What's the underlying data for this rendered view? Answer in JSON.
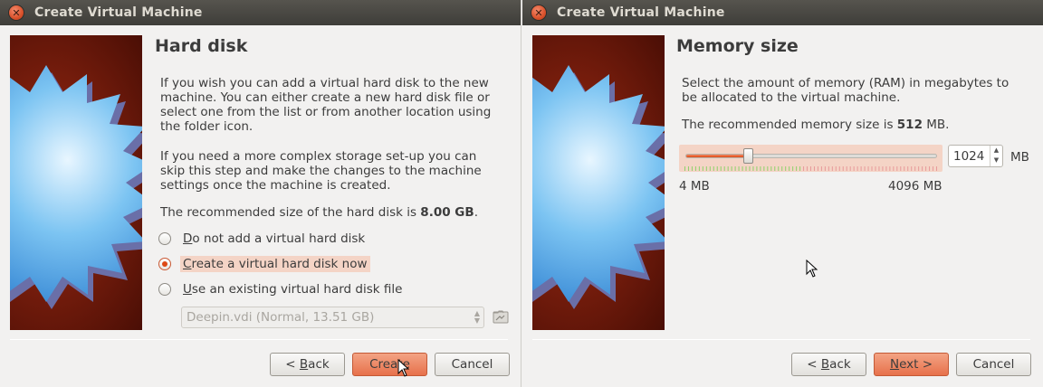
{
  "left_dialog": {
    "title": "Create Virtual Machine",
    "heading": "Hard disk",
    "para1": "If you wish you can add a virtual hard disk to the new machine. You can either create a new hard disk file or select one from the list or from another location using the folder icon.",
    "para2": "If you need a more complex storage set-up you can skip this step and make the changes to the machine settings once the machine is created.",
    "recommended_prefix": "The recommended size of the hard disk is ",
    "recommended_value": "8.00 GB",
    "recommended_suffix": ".",
    "options": [
      {
        "label_u": "D",
        "label_rest": "o not add a virtual hard disk",
        "checked": false
      },
      {
        "label_u": "C",
        "label_rest": "reate a virtual hard disk now",
        "checked": true
      },
      {
        "label_u": "U",
        "label_rest": "se an existing virtual hard disk file",
        "checked": false
      }
    ],
    "existing_disk_value": "Deepin.vdi (Normal, 13.51 GB)",
    "buttons": {
      "back_lt": "< ",
      "back_u": "B",
      "back_rest": "ack",
      "create": "Create",
      "cancel": "Cancel"
    }
  },
  "right_dialog": {
    "title": "Create Virtual Machine",
    "heading": "Memory size",
    "para1": "Select the amount of memory (RAM) in megabytes to be allocated to the virtual machine.",
    "recommended_prefix": "The recommended memory size is ",
    "recommended_value": "512",
    "recommended_suffix": " MB.",
    "slider": {
      "min_label": "4 MB",
      "max_label": "4096 MB",
      "value": 1024,
      "min": 4,
      "max": 4096
    },
    "spin_value": "1024",
    "unit": "MB",
    "buttons": {
      "back_lt": "< ",
      "back_u": "B",
      "back_rest": "ack",
      "next_u": "N",
      "next_rest": "ext >",
      "cancel": "Cancel"
    }
  },
  "colors": {
    "accent": "#dd4814",
    "highlight": "#f4d4c6",
    "titlebar": "#3e3d39"
  }
}
